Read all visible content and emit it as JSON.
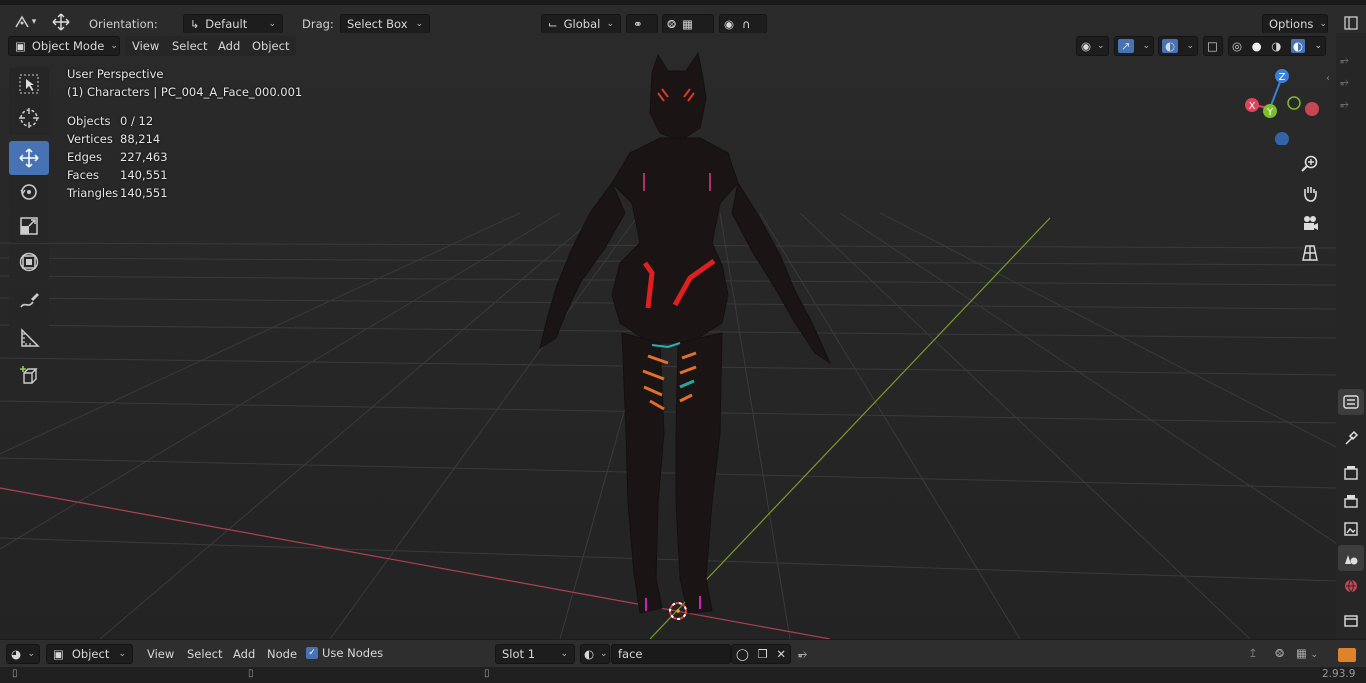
{
  "topbar": {
    "orientation_label": "Orientation:",
    "orientation_value": "Default",
    "drag_label": "Drag:",
    "drag_value": "Select Box",
    "transform_space": "Global",
    "options_label": "Options"
  },
  "header": {
    "mode": "Object Mode",
    "menus": [
      "View",
      "Select",
      "Add",
      "Object"
    ]
  },
  "viewport": {
    "view_name": "User Perspective",
    "collection": "(1) Characters | PC_004_A_Face_000.001",
    "stats": [
      {
        "label": "Objects",
        "value": "0 / 12"
      },
      {
        "label": "Vertices",
        "value": "88,214"
      },
      {
        "label": "Edges",
        "value": "227,463"
      },
      {
        "label": "Faces",
        "value": "140,551"
      },
      {
        "label": "Triangles",
        "value": "140,551"
      }
    ],
    "gizmo": {
      "z": "Z",
      "y": "Y",
      "x": "X"
    }
  },
  "toolbar": {
    "tools": [
      "select-box-tool",
      "cursor-tool",
      "move-tool",
      "rotate-tool",
      "scale-tool",
      "transform-tool",
      "annotate-tool",
      "measure-tool",
      "add-cube-tool"
    ],
    "active": "move-tool"
  },
  "nodebar": {
    "editor_type": "Object",
    "menus": [
      "View",
      "Select",
      "Add",
      "Node"
    ],
    "use_nodes_label": "Use Nodes",
    "use_nodes_checked": true,
    "slot": "Slot 1",
    "material_name": "face"
  },
  "status": {
    "version": "2.93.9"
  },
  "colors": {
    "accent": "#4772b3",
    "axis_x": "#e0445a",
    "axis_y": "#7bbf2a",
    "axis_z": "#3b7fd6"
  }
}
